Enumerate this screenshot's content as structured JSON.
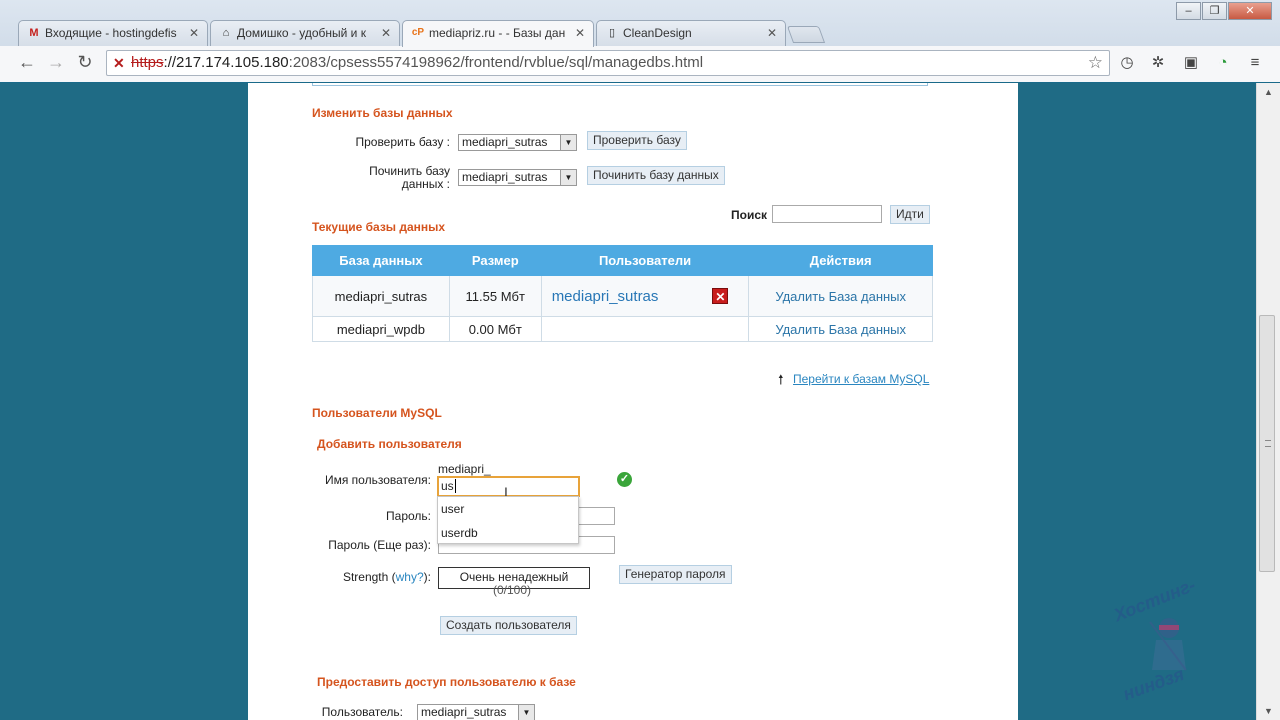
{
  "browser": {
    "tabs": [
      {
        "label": "Входящие - hostingdefis",
        "icon": "gmail-icon"
      },
      {
        "label": "Домишко - удобный и к",
        "icon": "house-icon"
      },
      {
        "label": "mediapriz.ru - - Базы дан",
        "icon": "cpanel-icon",
        "active": true
      },
      {
        "label": "CleanDesign",
        "icon": "page-icon"
      }
    ],
    "close_symbol": "✕",
    "url": {
      "scheme": "https",
      "host": "://217.174.105.180",
      "rest": ":2083/cpsess5574198962/frontend/rvblue/sql/managedbs.html"
    }
  },
  "modify": {
    "title": "Изменить базы данных",
    "check_label": "Проверить базу :",
    "check_select": "mediapri_sutras",
    "check_button": "Проверить базу",
    "repair_label_1": "Починить базу",
    "repair_label_2": "данных :",
    "repair_select": "mediapri_sutras",
    "repair_button": "Починить базу данных"
  },
  "search": {
    "label": "Поиск",
    "value": "",
    "button": "Идти"
  },
  "current": {
    "title": "Текущие базы данных",
    "columns": [
      "База данных",
      "Размер",
      "Пользователи",
      "Действия"
    ],
    "rows": [
      {
        "db": "mediapri_sutras",
        "size": "11.55 Мбт",
        "user": "mediapri_sutras",
        "action": "Удалить База данных"
      },
      {
        "db": "mediapri_wpdb",
        "size": "0.00 Мбт",
        "user": "",
        "action": "Удалить База данных"
      }
    ],
    "goto_link": "Перейти к базам MySQL"
  },
  "mysql_users": {
    "title": "Пользователи MySQL",
    "add_title": "Добавить пользователя",
    "prefix": "mediapri_",
    "username_label": "Имя пользователя:",
    "username_value": "us",
    "suggestions": [
      "user",
      "userdb"
    ],
    "password_label": "Пароль:",
    "password_repeat_label": "Пароль (Еще раз):",
    "strength_label": "Strength (",
    "strength_why": "why?",
    "strength_label_end": "):",
    "strength_text": "Очень ненадежный",
    "strength_value": "(0/100)",
    "generator_button": "Генератор пароля",
    "create_button": "Создать пользователя"
  },
  "grant": {
    "title": "Предоставить доступ пользователю к базе",
    "user_label": "Пользователь:",
    "user_select": "mediapri_sutras"
  },
  "watermark": {
    "line1": "Хостинг-",
    "line2": "ниндзя"
  }
}
